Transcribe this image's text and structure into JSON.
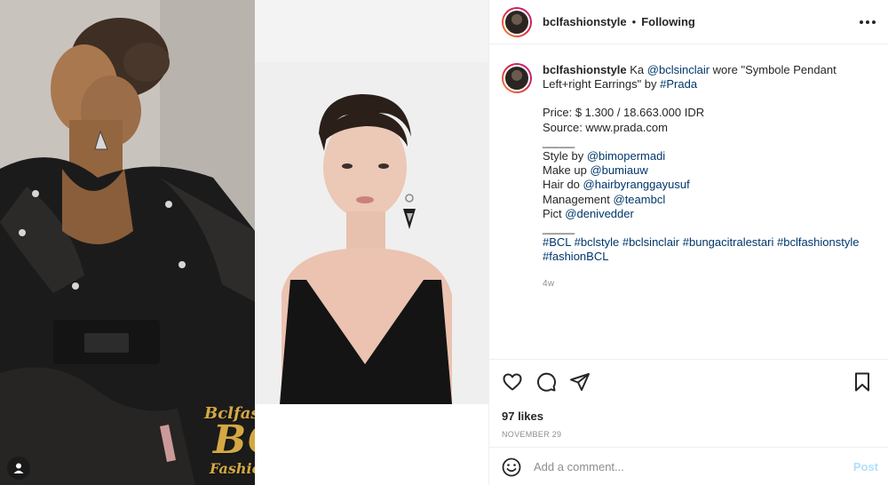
{
  "watermark": {
    "line1": "Bclfashionstyle",
    "line2": "BCL",
    "line3": "Fashion Style"
  },
  "header": {
    "username": "bclfashionstyle",
    "dot": "•",
    "follow_status": "Following",
    "more_icon": "more-horizontal-icon"
  },
  "caption": {
    "username": "bclfashionstyle",
    "intro_1": " Ka ",
    "mention_bclsinclair": "@bclsinclair",
    "intro_2": " wore \"Symbole Pendant Left+right Earrings\" by ",
    "hashtag_prada": "#Prada",
    "price": "Price: $ 1.300 / 18.663.000 IDR",
    "source": "Source: www.prada.com",
    "divider1": "_____",
    "style_label": "Style by ",
    "style_mention": "@bimopermadi",
    "makeup_label": "Make up ",
    "makeup_mention": "@bumiauw",
    "hair_label": "Hair do ",
    "hair_mention": "@hairbyranggayusuf",
    "mgmt_label": "Management ",
    "mgmt_mention": "@teambcl",
    "pict_label": "Pict ",
    "pict_mention": "@denivedder",
    "divider2": "_____",
    "hashtags_line1": "#BCL #bclstyle #bclsinclair #bungacitralestari #bclfashionstyle",
    "hashtags_line2": "#fashionBCL",
    "time": "4w"
  },
  "actions": {
    "icons": [
      "heart-icon",
      "comment-icon",
      "share-icon",
      "bookmark-icon"
    ],
    "likes": "97 likes",
    "date": "NOVEMBER 29"
  },
  "comment": {
    "emoji_icon": "smiley-icon",
    "placeholder": "Add a comment...",
    "post_label": "Post"
  },
  "colors": {
    "link": "#00376b",
    "muted": "#8e8e8e",
    "post_disabled": "#b2dffc",
    "watermark": "#d4a843"
  }
}
